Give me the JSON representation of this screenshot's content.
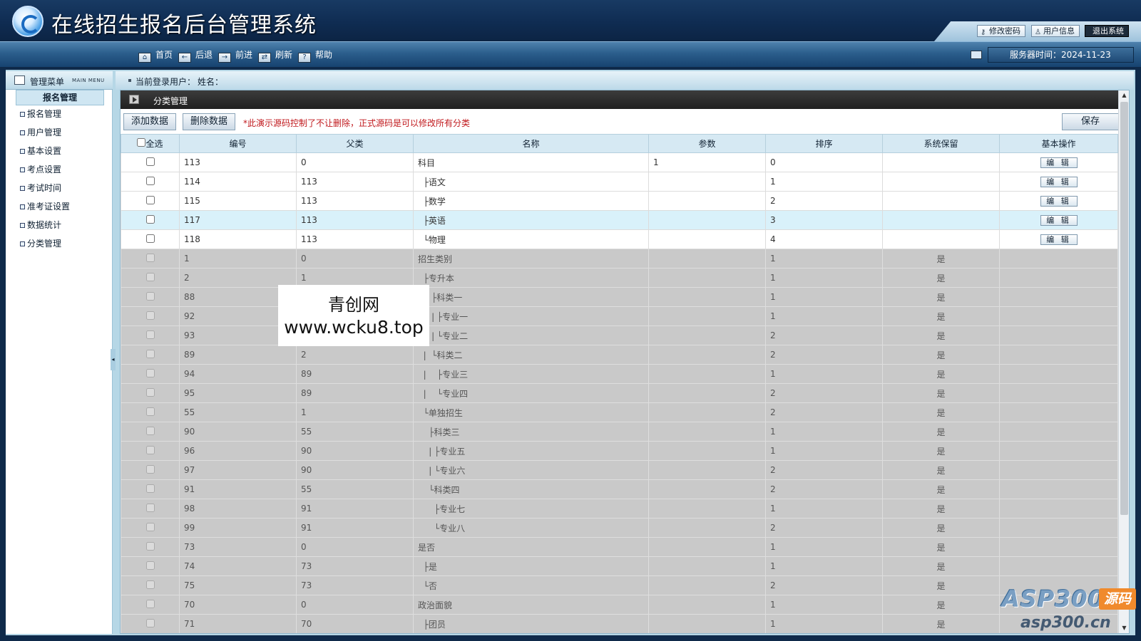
{
  "header": {
    "title": "在线招生报名后台管理系统",
    "buttons": {
      "password": "修改密码",
      "userinfo": "用户信息",
      "logout": "退出系统"
    }
  },
  "toolbar": {
    "items": [
      {
        "label": "首页",
        "icon": "home-icon"
      },
      {
        "label": "后退",
        "icon": "arrow-left-icon"
      },
      {
        "label": "前进",
        "icon": "arrow-right-icon"
      },
      {
        "label": "刷新",
        "icon": "refresh-icon"
      },
      {
        "label": "帮助",
        "icon": "help-icon"
      }
    ],
    "server_time": "服务器时间：2024-11-23"
  },
  "sidebar": {
    "title": "管理菜单",
    "subtitle": "MAIN MENU",
    "group": "报名管理",
    "items": [
      "报名管理",
      "用户管理",
      "基本设置",
      "考点设置",
      "考试时间",
      "准考证设置",
      "数据统计",
      "分类管理"
    ]
  },
  "infobar": {
    "user_label": "当前登录用户：",
    "name_label": "姓名："
  },
  "content": {
    "section_title": "分类管理",
    "add_button": "添加数据",
    "delete_button": "删除数据",
    "save_button": "保存",
    "notice": "*此演示源码控制了不让删除，正式源码是可以修改所有分类"
  },
  "table": {
    "select_all": "全选",
    "columns": [
      "编号",
      "父类",
      "名称",
      "参数",
      "排序",
      "系统保留",
      "基本操作"
    ],
    "edit_label": "编 辑",
    "rows": [
      {
        "id": "113",
        "parent": "0",
        "name": "科目",
        "param": "1",
        "sort": "0",
        "reserved": "",
        "editable": true
      },
      {
        "id": "114",
        "parent": "113",
        "name": "  ├语文",
        "param": "",
        "sort": "1",
        "reserved": "",
        "editable": true
      },
      {
        "id": "115",
        "parent": "113",
        "name": "  ├数学",
        "param": "",
        "sort": "2",
        "reserved": "",
        "editable": true
      },
      {
        "id": "117",
        "parent": "113",
        "name": "  ├英语",
        "param": "",
        "sort": "3",
        "reserved": "",
        "editable": true,
        "highlight": true
      },
      {
        "id": "118",
        "parent": "113",
        "name": "  └物理",
        "param": "",
        "sort": "4",
        "reserved": "",
        "editable": true
      },
      {
        "id": "1",
        "parent": "0",
        "name": "招生类别",
        "param": "",
        "sort": "1",
        "reserved": "是",
        "editable": false
      },
      {
        "id": "2",
        "parent": "1",
        "name": "  ├专升本",
        "param": "",
        "sort": "1",
        "reserved": "是",
        "editable": false
      },
      {
        "id": "88",
        "parent": "",
        "name": "     ├科类一",
        "param": "",
        "sort": "1",
        "reserved": "是",
        "editable": false
      },
      {
        "id": "92",
        "parent": "",
        "name": "     | ├专业一",
        "param": "",
        "sort": "1",
        "reserved": "是",
        "editable": false
      },
      {
        "id": "93",
        "parent": "",
        "name": "     | └专业二",
        "param": "",
        "sort": "2",
        "reserved": "是",
        "editable": false
      },
      {
        "id": "89",
        "parent": "2",
        "name": "  |  └科类二",
        "param": "",
        "sort": "2",
        "reserved": "是",
        "editable": false
      },
      {
        "id": "94",
        "parent": "89",
        "name": "  |    ├专业三",
        "param": "",
        "sort": "1",
        "reserved": "是",
        "editable": false
      },
      {
        "id": "95",
        "parent": "89",
        "name": "  |    └专业四",
        "param": "",
        "sort": "2",
        "reserved": "是",
        "editable": false
      },
      {
        "id": "55",
        "parent": "1",
        "name": "  └单独招生",
        "param": "",
        "sort": "2",
        "reserved": "是",
        "editable": false
      },
      {
        "id": "90",
        "parent": "55",
        "name": "    ├科类三",
        "param": "",
        "sort": "1",
        "reserved": "是",
        "editable": false
      },
      {
        "id": "96",
        "parent": "90",
        "name": "    | ├专业五",
        "param": "",
        "sort": "1",
        "reserved": "是",
        "editable": false
      },
      {
        "id": "97",
        "parent": "90",
        "name": "    | └专业六",
        "param": "",
        "sort": "2",
        "reserved": "是",
        "editable": false
      },
      {
        "id": "91",
        "parent": "55",
        "name": "    └科类四",
        "param": "",
        "sort": "2",
        "reserved": "是",
        "editable": false
      },
      {
        "id": "98",
        "parent": "91",
        "name": "      ├专业七",
        "param": "",
        "sort": "1",
        "reserved": "是",
        "editable": false
      },
      {
        "id": "99",
        "parent": "91",
        "name": "      └专业八",
        "param": "",
        "sort": "2",
        "reserved": "是",
        "editable": false
      },
      {
        "id": "73",
        "parent": "0",
        "name": "是否",
        "param": "",
        "sort": "1",
        "reserved": "是",
        "editable": false
      },
      {
        "id": "74",
        "parent": "73",
        "name": "  ├是",
        "param": "",
        "sort": "1",
        "reserved": "是",
        "editable": false
      },
      {
        "id": "75",
        "parent": "73",
        "name": "  └否",
        "param": "",
        "sort": "2",
        "reserved": "是",
        "editable": false
      },
      {
        "id": "70",
        "parent": "0",
        "name": "政治面貌",
        "param": "",
        "sort": "1",
        "reserved": "是",
        "editable": false
      },
      {
        "id": "71",
        "parent": "70",
        "name": "  ├团员",
        "param": "",
        "sort": "1",
        "reserved": "是",
        "editable": false
      }
    ]
  },
  "watermarks": {
    "site_name": "青创网",
    "site_url": "www.wcku8.top",
    "brand": "ASP300",
    "brand_tag": "源码",
    "brand_url": "asp300.cn"
  }
}
